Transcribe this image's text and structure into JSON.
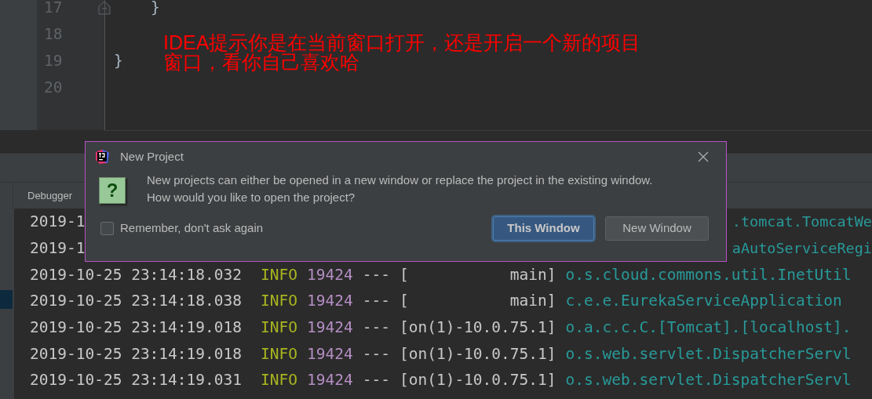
{
  "editor": {
    "lines": [
      {
        "number": "17",
        "code": "    }",
        "kind": "fold-end"
      },
      {
        "number": "18",
        "kind": "plain"
      },
      {
        "number": "19",
        "code": "}",
        "kind": "plain"
      },
      {
        "number": "20",
        "kind": "plain"
      }
    ],
    "annotation": [
      "IDEA提示你是在当前窗口打开，还是开启一个新的项目",
      "窗口，看你自己喜欢哈"
    ]
  },
  "tool_window": {
    "tab": "Debugger"
  },
  "console": {
    "rows": [
      {
        "kind": "partial",
        "left": "2019-1",
        "right": ".tomcat.TomcatWe"
      },
      {
        "kind": "partial",
        "left": "2019-1",
        "right": "aAutoServiceRegi"
      },
      {
        "kind": "full",
        "time": "2019-10-25 23:14:18.032",
        "level": "INFO",
        "pid": "19424",
        "sep": "---",
        "thread": "[           main]",
        "logger": "o.s.cloud.commons.util.InetUtil"
      },
      {
        "kind": "full",
        "time": "2019-10-25 23:14:18.038",
        "level": "INFO",
        "pid": "19424",
        "sep": "---",
        "thread": "[           main]",
        "logger": "c.e.e.EurekaServiceApplication"
      },
      {
        "kind": "full",
        "time": "2019-10-25 23:14:19.018",
        "level": "INFO",
        "pid": "19424",
        "sep": "---",
        "thread": "[on(1)-10.0.75.1]",
        "logger": "o.a.c.c.C.[Tomcat].[localhost]."
      },
      {
        "kind": "full",
        "time": "2019-10-25 23:14:19.018",
        "level": "INFO",
        "pid": "19424",
        "sep": "---",
        "thread": "[on(1)-10.0.75.1]",
        "logger": "o.s.web.servlet.DispatcherServl"
      },
      {
        "kind": "full",
        "time": "2019-10-25 23:14:19.031",
        "level": "INFO",
        "pid": "19424",
        "sep": "---",
        "thread": "[on(1)-10.0.75.1]",
        "logger": "o.s.web.servlet.DispatcherServl"
      }
    ]
  },
  "dialog": {
    "title": "New Project",
    "icon_glyph": "?",
    "message": [
      "New projects can either be opened in a new window or replace the project in the existing window.",
      "How would you like to open the project?"
    ],
    "remember": {
      "label": "Remember, don't ask again",
      "checked": false
    },
    "buttons": [
      {
        "label": "This Window",
        "selected": true
      },
      {
        "label": "New Window",
        "selected": false
      }
    ]
  }
}
